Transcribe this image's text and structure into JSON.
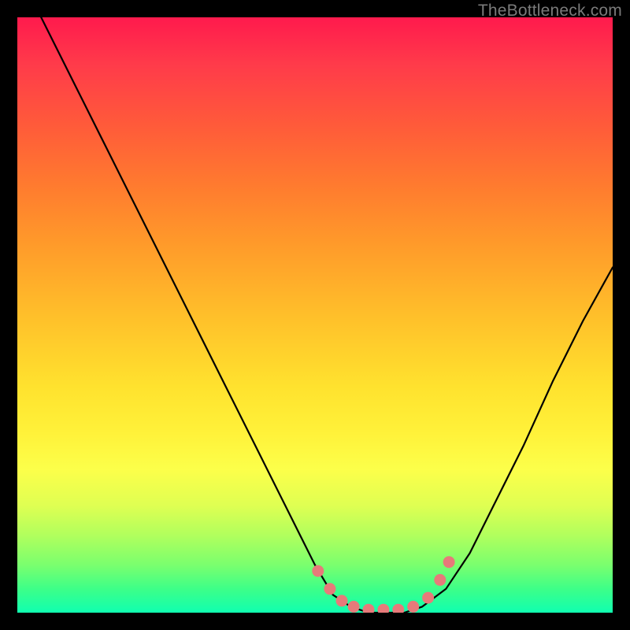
{
  "watermark": "TheBottleneck.com",
  "chart_data": {
    "type": "line",
    "title": "",
    "xlabel": "",
    "ylabel": "",
    "xlim": [
      0,
      100
    ],
    "ylim": [
      0,
      100
    ],
    "grid": false,
    "legend_position": "none",
    "series": [
      {
        "name": "bottleneck-curve",
        "x": [
          0,
          5,
          10,
          15,
          20,
          25,
          30,
          35,
          40,
          45,
          50,
          53,
          56,
          59,
          62,
          65,
          68,
          72,
          76,
          80,
          85,
          90,
          95,
          100
        ],
        "values": [
          108,
          98,
          88,
          78,
          68,
          58,
          48,
          38,
          28,
          18,
          8,
          3,
          1,
          0,
          0,
          0,
          1,
          4,
          10,
          18,
          28,
          39,
          49,
          58
        ]
      }
    ],
    "markers": {
      "name": "highlight-dots",
      "color": "#e77a7a",
      "points": [
        {
          "x": 50.5,
          "y": 7.0
        },
        {
          "x": 52.5,
          "y": 4.0
        },
        {
          "x": 54.5,
          "y": 2.0
        },
        {
          "x": 56.5,
          "y": 1.0
        },
        {
          "x": 59.0,
          "y": 0.5
        },
        {
          "x": 61.5,
          "y": 0.5
        },
        {
          "x": 64.0,
          "y": 0.5
        },
        {
          "x": 66.5,
          "y": 1.0
        },
        {
          "x": 69.0,
          "y": 2.5
        },
        {
          "x": 71.0,
          "y": 5.5
        },
        {
          "x": 72.5,
          "y": 8.5
        }
      ]
    },
    "gradient_stops": [
      {
        "pos": 0,
        "color": "#ff1a4d"
      },
      {
        "pos": 50,
        "color": "#ffbf2a"
      },
      {
        "pos": 76,
        "color": "#fcff4a"
      },
      {
        "pos": 100,
        "color": "#10ffb0"
      }
    ]
  }
}
